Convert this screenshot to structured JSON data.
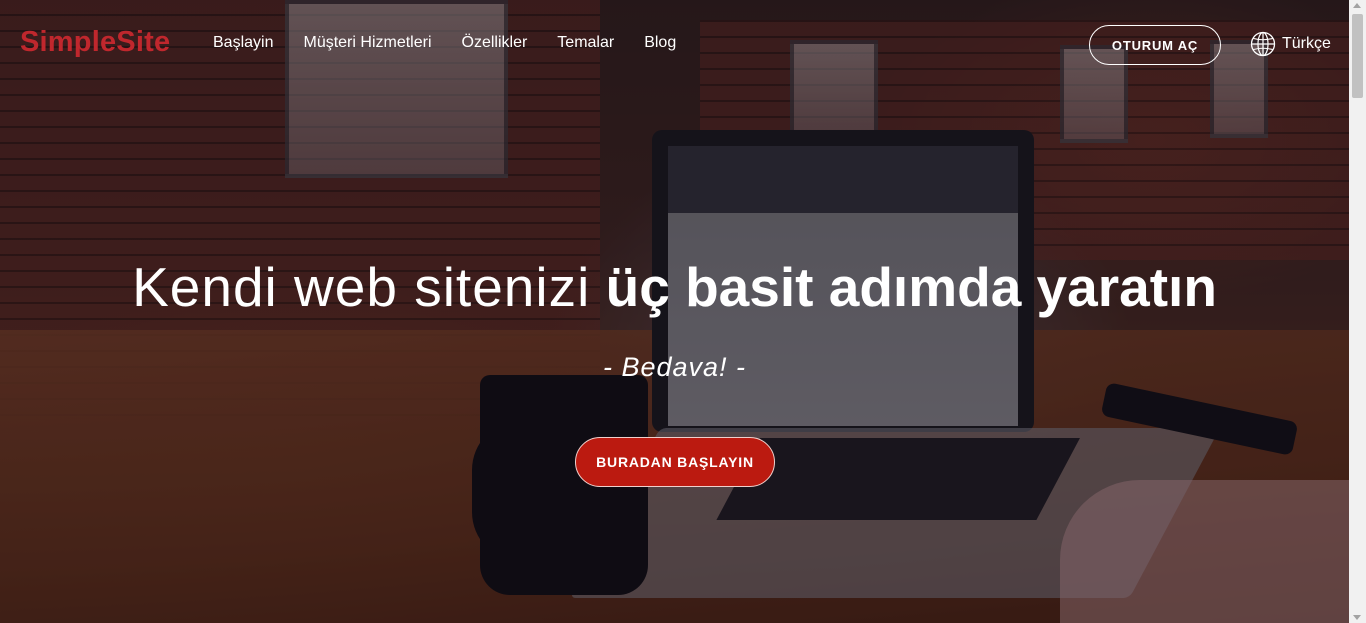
{
  "header": {
    "logo": "SimpleSite",
    "nav": [
      "Başlayin",
      "Müşteri Hizmetleri",
      "Özellikler",
      "Temalar",
      "Blog"
    ],
    "login_label": "OTURUM AÇ",
    "language": "Türkçe",
    "language_icon": "globe-icon"
  },
  "hero": {
    "headline_light": "Kendi web sitenizi",
    "headline_bold": "üç basit adımda yaratın",
    "subline": "- Bedava! -",
    "cta_label": "BURADAN BAŞLAYIN"
  },
  "colors": {
    "brand": "#c0272d",
    "cta_background": "#bb1a10",
    "text": "#ffffff"
  }
}
